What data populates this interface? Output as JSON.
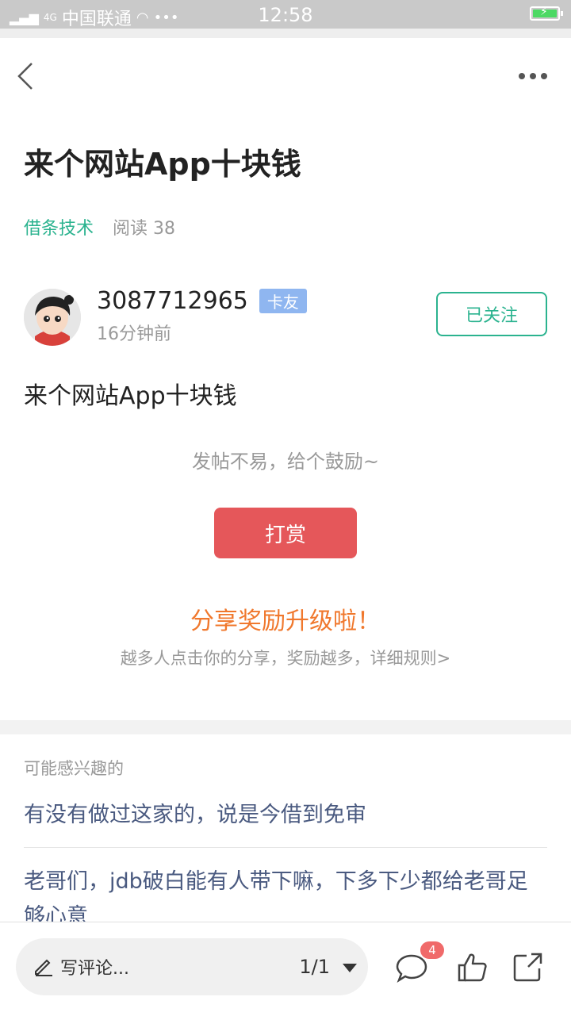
{
  "status_bar": {
    "network": "4G",
    "carrier": "中国联通",
    "time": "12:58"
  },
  "article": {
    "title": "来个网站App十块钱",
    "category": "借条技术",
    "reads": "阅读 38"
  },
  "author": {
    "name": "3087712965",
    "badge": "卡友",
    "time": "16分钟前",
    "follow_label": "已关注"
  },
  "content": {
    "text": "来个网站App十块钱"
  },
  "reward": {
    "encourage": "发帖不易，给个鼓励~",
    "tip_label": "打赏"
  },
  "share_promo": {
    "title": "分享奖励升级啦！",
    "subtitle": "越多人点击你的分享，奖励越多，详细规则>"
  },
  "recommend": {
    "title": "可能感兴趣的",
    "items": [
      "有没有做过这家的，说是今借到免审",
      "老哥们，jdb破白能有人带下嘛，下多下少都给老哥足够心意"
    ]
  },
  "bottom_bar": {
    "comment_placeholder": "写评论...",
    "pager": "1/1",
    "comment_count": "4"
  },
  "colors": {
    "accent_green": "#2bb38f",
    "tip_red": "#e5575a",
    "promo_orange": "#f0782d",
    "link_blue": "#4a5a80"
  }
}
